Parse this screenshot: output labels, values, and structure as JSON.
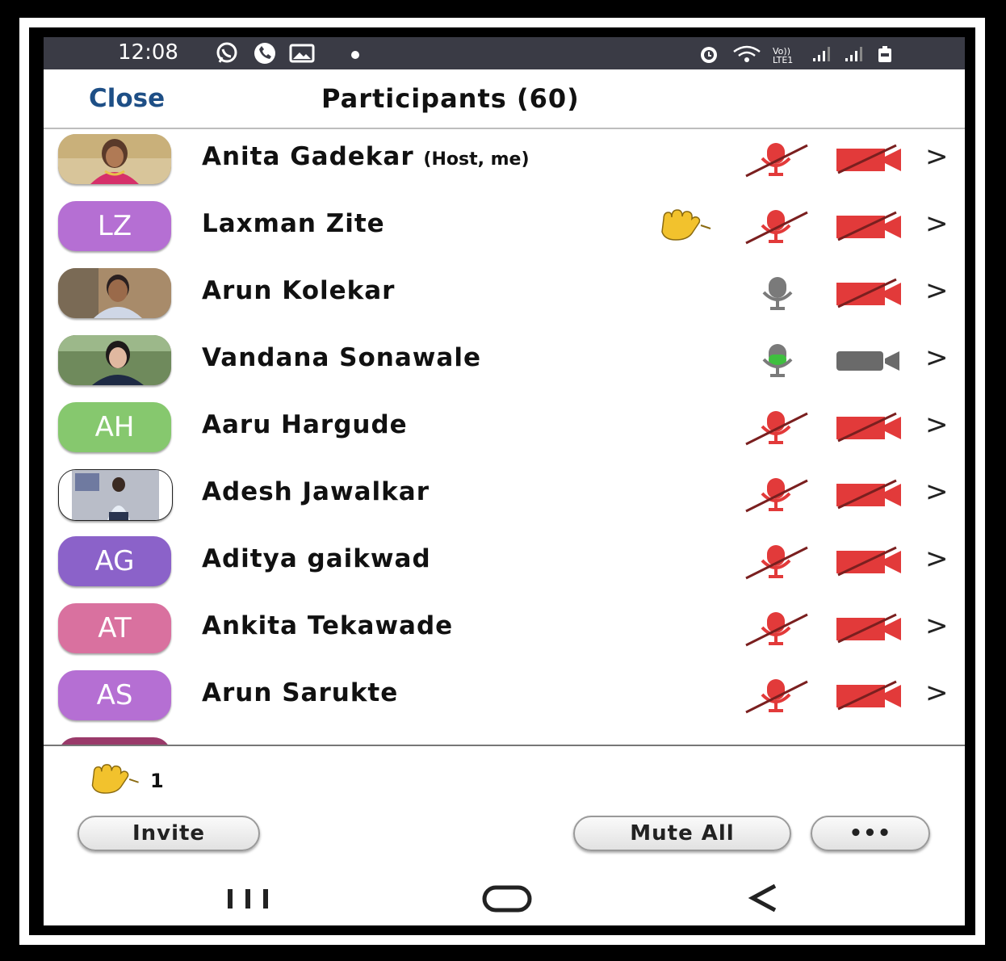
{
  "status_bar": {
    "time": "12:08",
    "network_label": "Vo)) LTE1",
    "icons": [
      "whatsapp-icon",
      "call-icon",
      "gallery-icon",
      "dot-icon",
      "alarm-icon",
      "wifi-icon",
      "signal-icon",
      "signal-icon",
      "battery-icon"
    ]
  },
  "header": {
    "close_label": "Close",
    "title": "Participants (60)"
  },
  "participants": [
    {
      "name": "Anita Gadekar",
      "tag": "(Host, me)",
      "avatar_type": "photo",
      "raised_hand": false,
      "mic": "muted",
      "video": "off"
    },
    {
      "name": "Laxman Zite",
      "initials": "LZ",
      "avatar_color": "#b56fd3",
      "raised_hand": true,
      "mic": "muted",
      "video": "off"
    },
    {
      "name": "Arun Kolekar",
      "avatar_type": "photo",
      "raised_hand": false,
      "mic": "unmuted",
      "video": "off"
    },
    {
      "name": "Vandana Sonawale",
      "avatar_type": "photo",
      "raised_hand": false,
      "mic": "speaking",
      "video": "on"
    },
    {
      "name": "Aaru Hargude",
      "initials": "AH",
      "avatar_color": "#86c86e",
      "raised_hand": false,
      "mic": "muted",
      "video": "off"
    },
    {
      "name": "Adesh Jawalkar",
      "avatar_type": "photo",
      "raised_hand": false,
      "mic": "muted",
      "video": "off"
    },
    {
      "name": "Aditya gaikwad",
      "initials": "AG",
      "avatar_color": "#8b62c9",
      "raised_hand": false,
      "mic": "muted",
      "video": "off"
    },
    {
      "name": "Ankita Tekawade",
      "initials": "AT",
      "avatar_color": "#d9719f",
      "raised_hand": false,
      "mic": "muted",
      "video": "off"
    },
    {
      "name": "Arun Sarukte",
      "initials": "AS",
      "avatar_color": "#b56fd3",
      "raised_hand": false,
      "mic": "muted",
      "video": "off"
    }
  ],
  "footer": {
    "raised_hands_count": "1",
    "invite_label": "Invite",
    "mute_all_label": "Mute All",
    "more_label": "•••"
  },
  "colors": {
    "status_bar_bg": "#3a3b45",
    "close_text": "#1e4f86",
    "muted_red": "#e23a3a",
    "mic_grey": "#7a7a7a",
    "speaking_green": "#3fbf3f"
  }
}
